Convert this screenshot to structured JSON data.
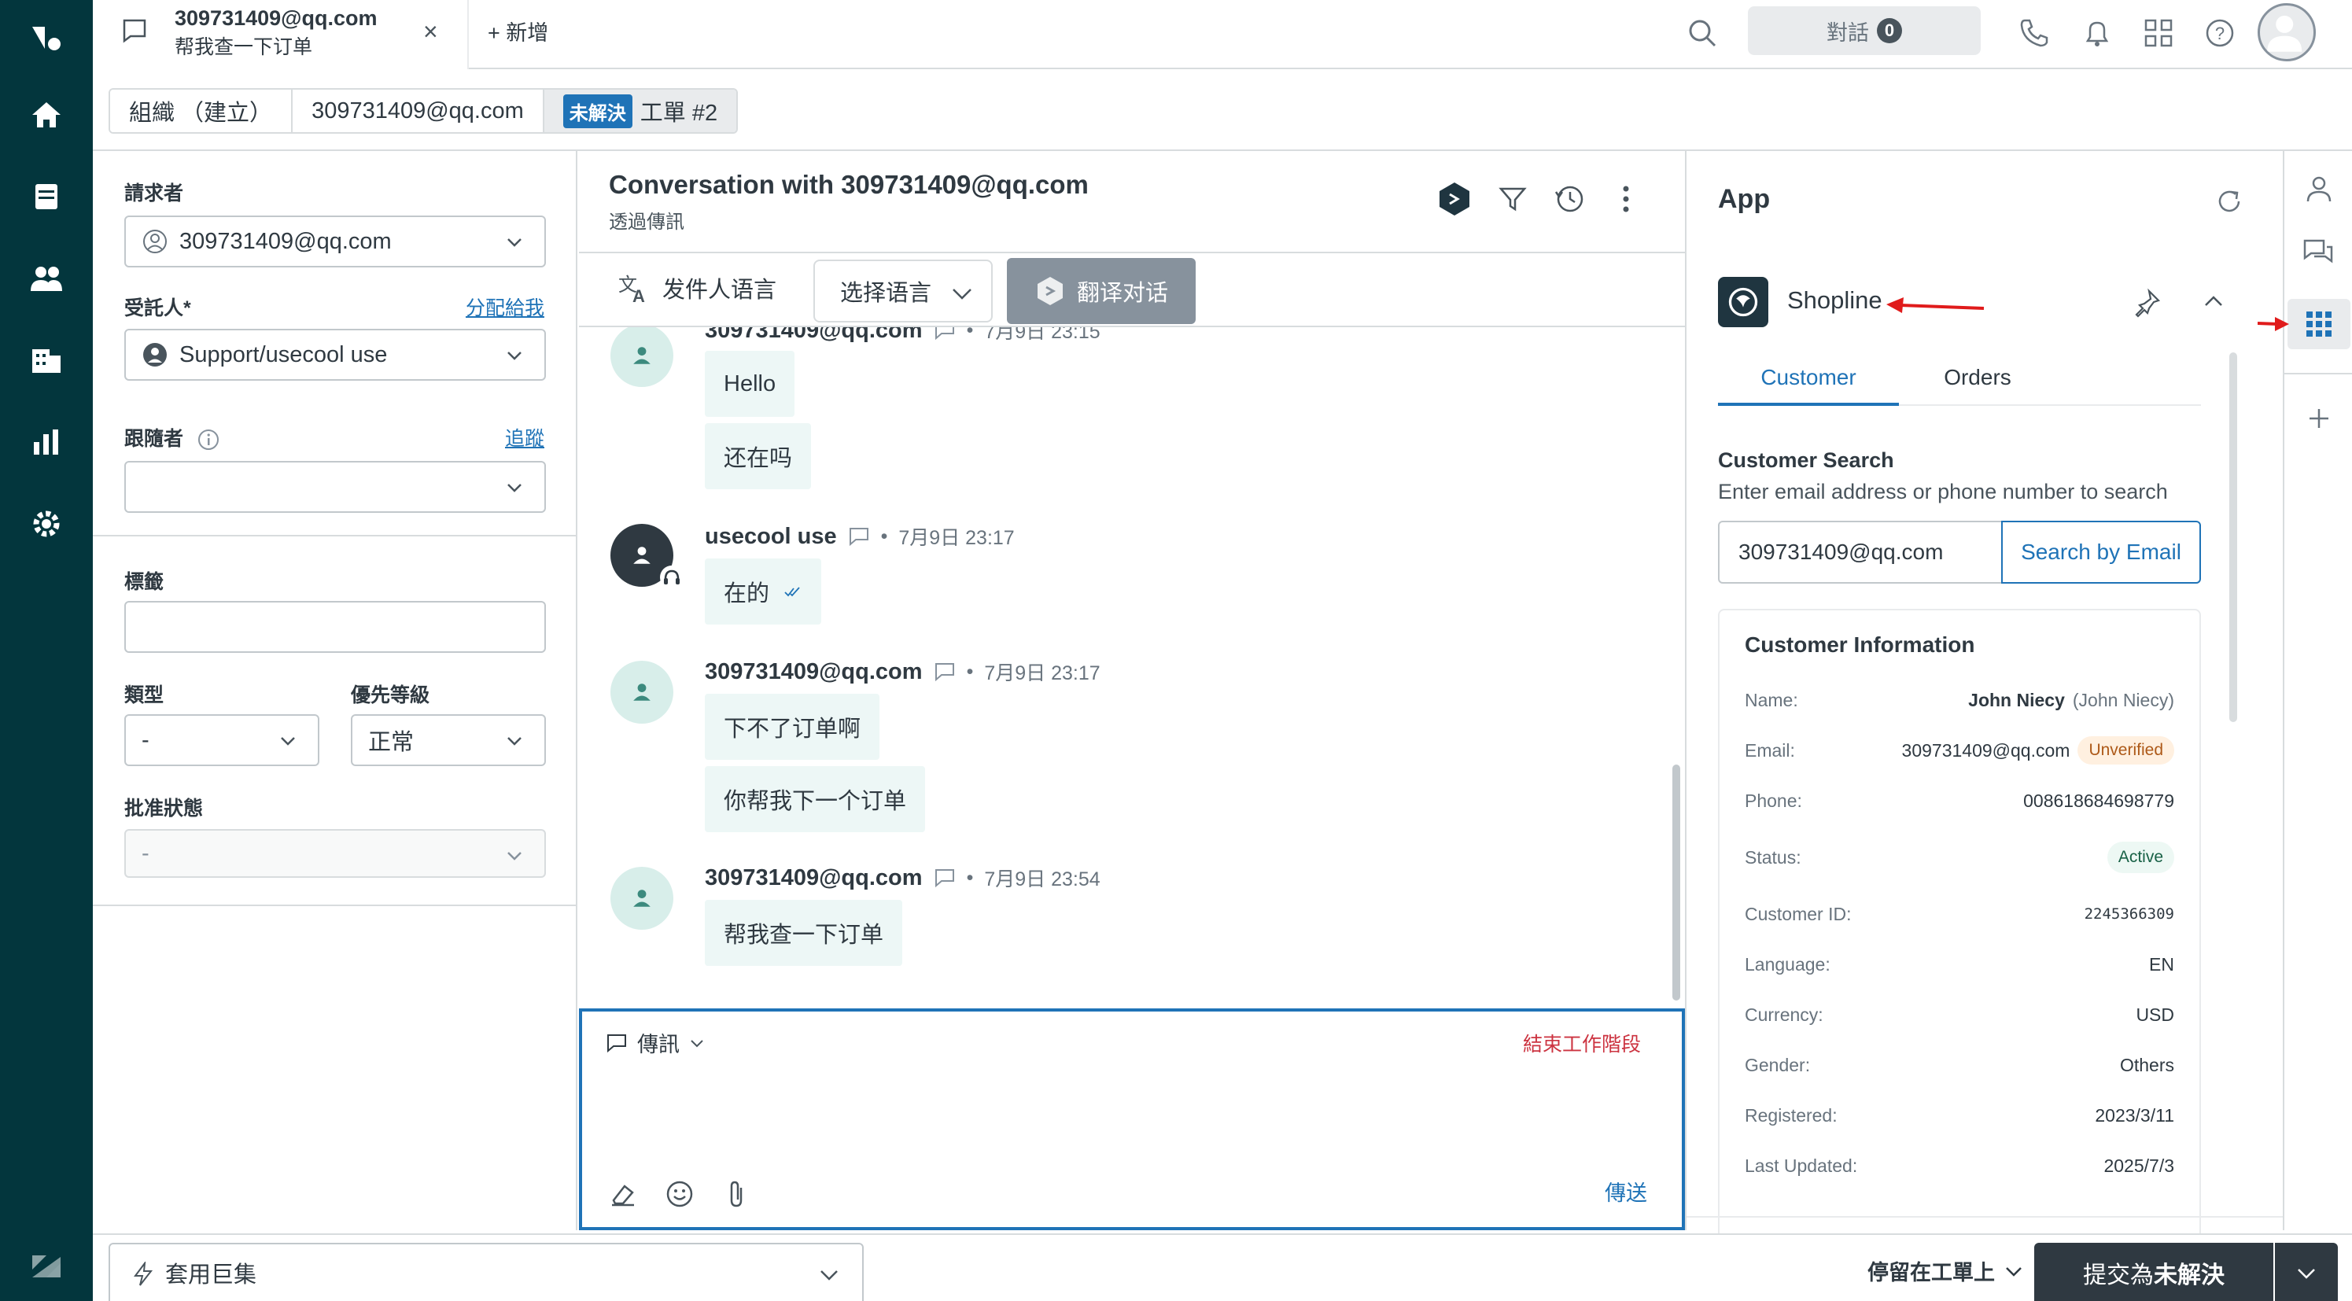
{
  "tab": {
    "title": "309731409@qq.com",
    "subtitle": "帮我查一下订单",
    "add_label": "+ 新增"
  },
  "topbar": {
    "conversations_label": "對話",
    "conversations_count": "0"
  },
  "breadcrumb": {
    "org": "組織 （建立）",
    "user": "309731409@qq.com",
    "status_badge": "未解決",
    "ticket": "工單 #2"
  },
  "props": {
    "requester_label": "請求者",
    "requester_value": "309731409@qq.com",
    "assignee_label": "受託人*",
    "assign_me_link": "分配給我",
    "assignee_value": "Support/usecool use",
    "followers_label": "跟隨者",
    "follow_link": "追蹤",
    "tags_label": "標籤",
    "type_label": "類型",
    "type_value": "-",
    "priority_label": "優先等級",
    "priority_value": "正常",
    "approval_label": "批准狀態",
    "approval_value": "-"
  },
  "conversation": {
    "title": "Conversation with 309731409@qq.com",
    "subtitle": "透過傳訊",
    "sender_lang_label": "发件人语言",
    "select_lang_label": "选择语言",
    "translate_button": "翻译对话",
    "messages": [
      {
        "author": "309731409@qq.com",
        "time": "7月9日 23:15",
        "bubbles": [
          "Hello",
          "还在吗"
        ]
      },
      {
        "author": "usecool use",
        "time": "7月9日 23:17",
        "bubbles": [
          "在的"
        ]
      },
      {
        "author": "309731409@qq.com",
        "time": "7月9日 23:17",
        "bubbles": [
          "下不了订单啊",
          "你帮我下一个订单"
        ]
      },
      {
        "author": "309731409@qq.com",
        "time": "7月9日 23:54",
        "bubbles": [
          "帮我查一下订单"
        ]
      }
    ],
    "sep": "•",
    "composer_type": "傳訊",
    "end_session": "結束工作階段",
    "send_label": "傳送"
  },
  "app": {
    "title": "App",
    "shop_name": "Shopline",
    "tabs": [
      "Customer",
      "Orders"
    ],
    "search_title": "Customer Search",
    "search_desc": "Enter email address or phone number to search",
    "search_value": "309731409@qq.com",
    "search_button": "Search by Email",
    "info_title": "Customer Information",
    "info": {
      "name_key": "Name:",
      "name_val": "John Niecy",
      "name_alias": "(John Niecy)",
      "email_key": "Email:",
      "email_val": "309731409@qq.com",
      "email_status": "Unverified",
      "phone_key": "Phone:",
      "phone_val": "008618684698779",
      "status_key": "Status:",
      "status_val": "Active",
      "id_key": "Customer ID:",
      "id_val": "2245366309",
      "lang_key": "Language:",
      "lang_val": "EN",
      "currency_key": "Currency:",
      "currency_val": "USD",
      "gender_key": "Gender:",
      "gender_val": "Others",
      "registered_key": "Registered:",
      "registered_val": "2023/3/11",
      "updated_key": "Last Updated:",
      "updated_val": "2025/7/3"
    }
  },
  "bottom": {
    "macro_label": "套用巨集",
    "stay_label": "停留在工單上",
    "submit_prefix": "提交為",
    "submit_status": "未解決"
  },
  "colors": {
    "nav": "#03363d",
    "accent": "#1f73b7",
    "annotation": "#e01b1b"
  }
}
